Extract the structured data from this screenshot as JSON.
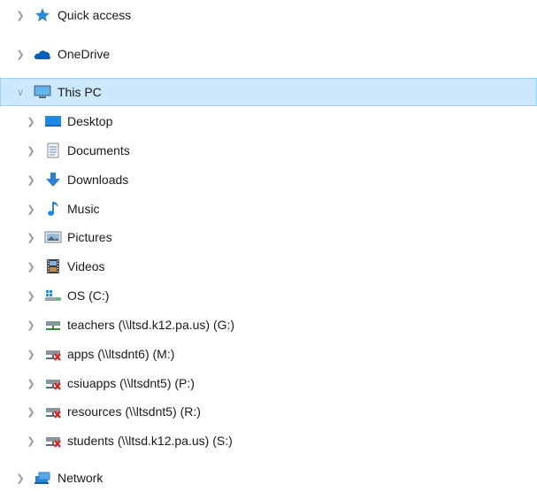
{
  "tree": {
    "quick_access": {
      "label": "Quick access",
      "icon": "star-icon"
    },
    "onedrive": {
      "label": "OneDrive",
      "icon": "cloud-icon"
    },
    "this_pc": {
      "label": "This PC",
      "icon": "computer-icon",
      "expanded": true,
      "selected": true
    },
    "children": [
      {
        "label": "Desktop",
        "icon": "desktop-icon"
      },
      {
        "label": "Documents",
        "icon": "documents-icon"
      },
      {
        "label": "Downloads",
        "icon": "download-arrow-icon"
      },
      {
        "label": "Music",
        "icon": "music-note-icon"
      },
      {
        "label": "Pictures",
        "icon": "pictures-icon"
      },
      {
        "label": "Videos",
        "icon": "film-icon"
      },
      {
        "label": "OS (C:)",
        "icon": "windows-drive-icon"
      },
      {
        "label": "teachers (\\\\ltsd.k12.pa.us) (G:)",
        "icon": "network-drive-icon"
      },
      {
        "label": "apps (\\\\ltsdnt6) (M:)",
        "icon": "disconnected-drive-icon"
      },
      {
        "label": "csiuapps (\\\\ltsdnt5) (P:)",
        "icon": "disconnected-drive-icon"
      },
      {
        "label": "resources (\\\\ltsdnt5) (R:)",
        "icon": "disconnected-drive-icon"
      },
      {
        "label": "students (\\\\ltsd.k12.pa.us) (S:)",
        "icon": "disconnected-drive-icon"
      }
    ],
    "network": {
      "label": "Network",
      "icon": "network-icon"
    }
  },
  "colors": {
    "selection_bg": "#cce8ff",
    "selection_border": "#99d1ff",
    "chevron": "#9a9a9a",
    "accent_blue": "#1e88e5"
  }
}
